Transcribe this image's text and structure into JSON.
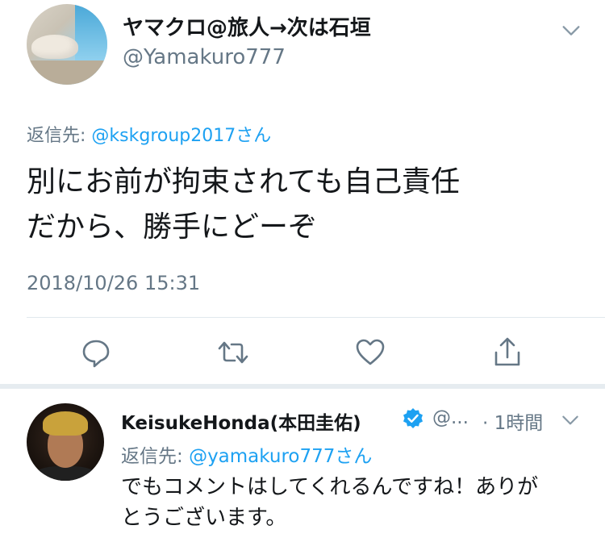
{
  "tweet": {
    "display_name": "ヤマクロ@旅人→次は石垣",
    "handle": "@Yamakuro777",
    "reply_prefix": "返信先: ",
    "reply_to": "@kskgroup2017さん",
    "text_line1": "別にお前が拘束されても自己責任",
    "text_line2": "だから、勝手にどーぞ",
    "timestamp": "2018/10/26 15:31"
  },
  "actions": [
    "reply-icon",
    "retweet-icon",
    "like-icon",
    "share-icon"
  ],
  "reply": {
    "display_name": "KeisukeHonda(本田圭佑)",
    "handle": "@...",
    "time": "· 1時間",
    "reply_prefix": "返信先: ",
    "reply_to": "@yamakuro777さん",
    "text_line1": "でもコメントはしてくれるんですね！ありが",
    "text_line2": "とうございます。"
  },
  "colors": {
    "accent": "#1da1f2",
    "secondary_text": "#657786",
    "primary_text": "#14171a",
    "divider": "#e1e8ed"
  }
}
